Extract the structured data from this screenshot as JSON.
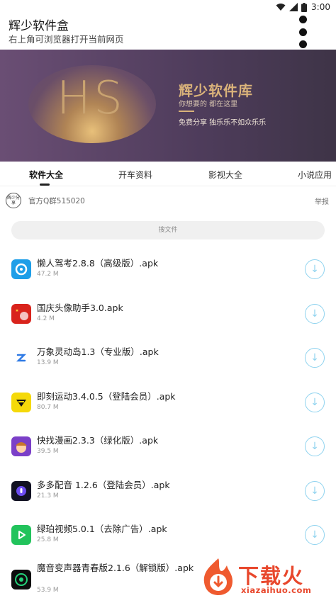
{
  "statusbar": {
    "time": "3:00"
  },
  "appbar": {
    "title": "辉少软件盒",
    "subtitle": "右上角可浏览器打开当前网页"
  },
  "banner": {
    "logo_text": "HS",
    "name": "辉少软件库",
    "tagline": "你想要的 都在这里",
    "slogan": "免费分享 独乐乐不如众乐乐"
  },
  "tabs": [
    {
      "label": "软件大全",
      "active": true
    },
    {
      "label": "开车资料",
      "active": false
    },
    {
      "label": "影视大全",
      "active": false
    },
    {
      "label": "小说应用",
      "active": false
    }
  ],
  "notice": {
    "logo_text": "辉少分享",
    "text": "官方Q群515020",
    "report": "举报"
  },
  "search": {
    "placeholder": "搜文件"
  },
  "files": [
    {
      "name": "懒人驾考2.8.8（高级版）.apk",
      "size": "47.2 M",
      "icon": "driving-test-app-icon",
      "color": "#1e9ee8"
    },
    {
      "name": "国庆头像助手3.0.apk",
      "size": "4.2 M",
      "icon": "national-day-avatar-app-icon",
      "color": "#d9231c"
    },
    {
      "name": "万象灵动岛1.3（专业版）.apk",
      "size": "13.9 M",
      "icon": "dynamic-island-app-icon",
      "color": "#ffffff"
    },
    {
      "name": "即刻运动3.4.0.5（登陆会员）.apk",
      "size": "80.7 M",
      "icon": "sport-app-icon",
      "color": "#f5d90a"
    },
    {
      "name": "快找漫画2.3.3（绿化版）.apk",
      "size": "39.5 M",
      "icon": "comic-app-icon",
      "color": "#7b3fc8"
    },
    {
      "name": "多多配音 1.2.6（登陆会员）.apk",
      "size": "21.3 M",
      "icon": "dubbing-app-icon",
      "color": "#111122"
    },
    {
      "name": "绿珀视频5.0.1（去除广告）.apk",
      "size": "25.8 M",
      "icon": "video-app-icon",
      "color": "#22c35c"
    },
    {
      "name": "魔音变声器青春版2.1.6（解锁版）.apk",
      "size": "53.9 M",
      "icon": "voice-changer-app-icon",
      "color": "#0d0d0d"
    }
  ],
  "watermark": {
    "title": "下载火",
    "url": "xiazaihuo.com"
  }
}
